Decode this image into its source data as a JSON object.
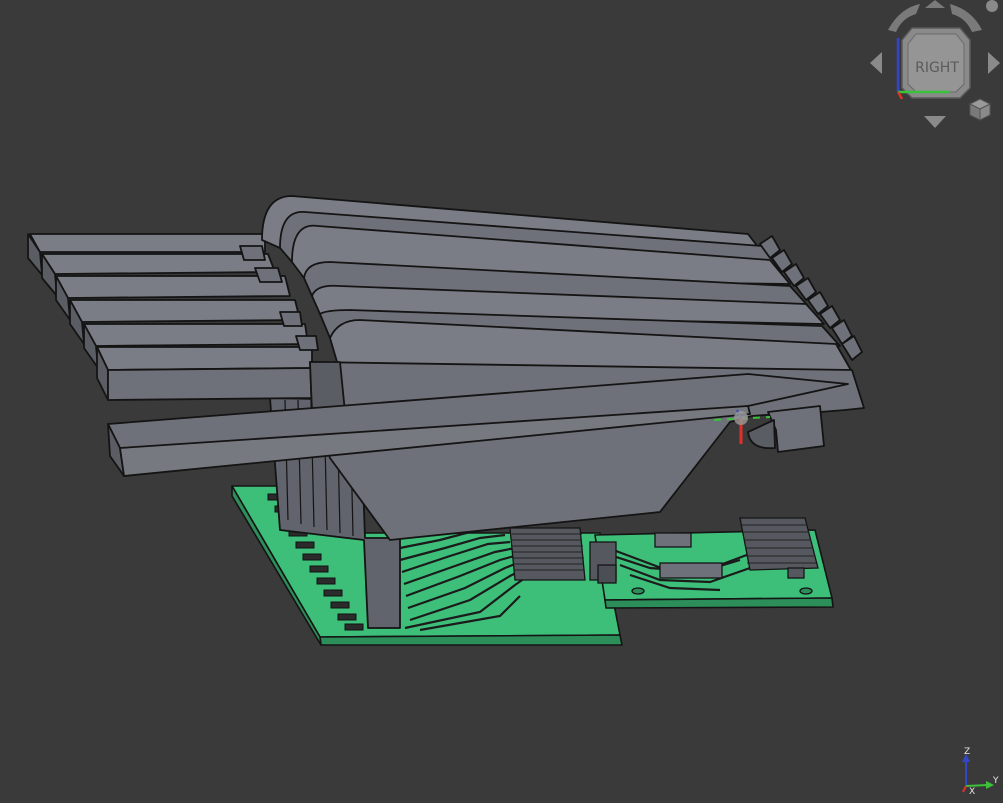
{
  "navcube": {
    "face_label": "RIGHT",
    "icons": [
      "rotate-left-icon",
      "rotate-right-icon",
      "arrow-up-icon",
      "arrow-down-icon",
      "arrow-left-icon",
      "arrow-right-icon",
      "view-menu-icon",
      "cube-icon"
    ]
  },
  "axis_triad": {
    "z": "Z",
    "y": "Y",
    "x": "X"
  },
  "colors": {
    "background": "#3a3a3a",
    "part_fill": "#6e7179",
    "part_outline": "#141414",
    "pcb_fill": "#3dbf7a",
    "axis_x": "#e0302a",
    "axis_y": "#3bc23b",
    "axis_z": "#3445c8"
  }
}
